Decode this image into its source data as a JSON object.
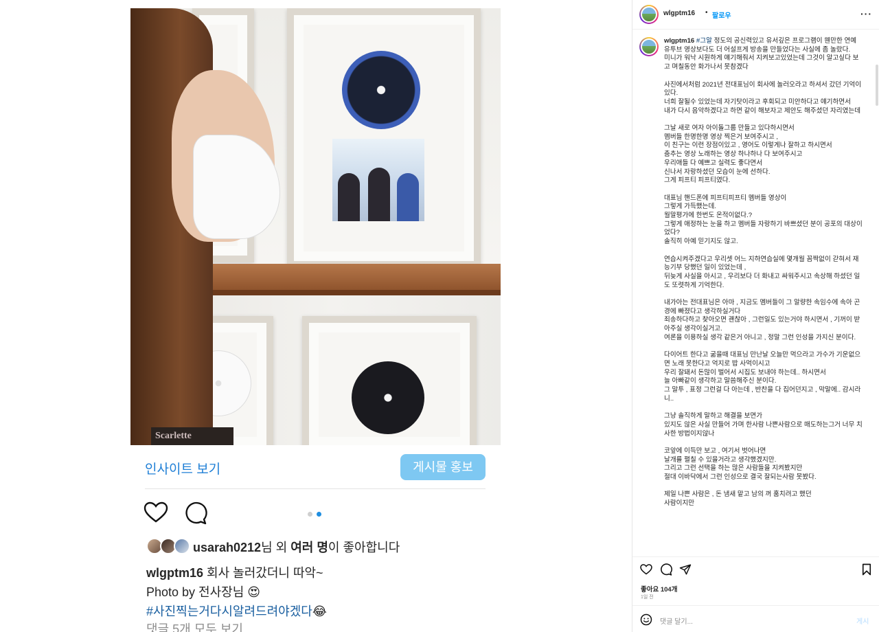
{
  "left_post": {
    "insights_label": "인사이트 보기",
    "promote_label": "게시물 홍보",
    "liked_by_user": "usarah0212",
    "liked_by_suffix": "님 외 ",
    "liked_by_others": "여러 명",
    "liked_by_end": "이 좋아합니다",
    "caption_user": "wlgptm16",
    "caption_line1": " 회사 놀러갔더니 따악~",
    "caption_line2": "Photo by 전사장님 😍",
    "caption_hashtag": "#사진찍는거다시알려드려야겠다",
    "caption_hashtag_emoji": "😂",
    "comments_link": "댓글 5개 모두 보기",
    "photo_label": "Scarlette"
  },
  "right_panel": {
    "header": {
      "username": "wlgptm16",
      "dot": "•",
      "follow_label": "팔로우",
      "more_label": "···"
    },
    "post": {
      "username": "wlgptm16",
      "hashtag": "#그알",
      "lines": [
        " 정도의 공신력있고 유서깊은 프로그램이 웬만한 연예 유투브 영상보다도 더 어설프게 방송을 만들었다는 사실에 좀 놀랐다.",
        "미니가 워낙 시원하게 얘기해줘서 지켜보고있었는데 그것이 알고싶다 보고 며칠동안 화가나서 못참겠다",
        "",
        "사진에서처럼 2021년 전대표님이 회사에 놀러오라고 하셔서 갔던 기억이있다.",
        "너희 잘될수 있었는데 자기탓이라고 후회되고 미안하다고 얘기하면서",
        "내가 다시 음악하겠다고 하면 같이 해보자고 제안도 해주셨던 자리였는데",
        "",
        "그날 새로 여자 아이돌그룹 만들고 있다하시면서",
        "멤버들 한명한명 영상 찍은거 보여주시고 ,",
        "이 친구는 이런 장점이있고 , 영어도 이렇게나 잘하고 하시면서",
        "춤추는 영상 노래하는 영상 하나하나 다 보여주시고",
        "우리애들 다 예쁘고 실력도 좋다면서",
        "신나서 자랑하셨던 모습이 눈에 선하다.",
        "그게 피프티 피프티였다.",
        "",
        "대표님 핸드폰에 피프티피프티 멤버들 영상이",
        "그렇게 가득했는데.",
        "월말평가에 한번도 온적이없다.?",
        "그렇게 애정하는 눈을 하고 멤버들 자랑하기 바쁘셨던 분이 공포의 대상이었다?",
        "솔직히 아예 믿기지도 않고.",
        "",
        "연습시켜주겠다고 우리셋 어느 지하연습실에 몇개월 꼼짝없이 갇혀서 재능기부 당했던 일이 있었는데 ,",
        "뒤늦게 사실을 아시고 , 우리보다 더 화내고 싸워주시고 속상해 하셨던 일도 또렷하게 기억한다.",
        "",
        "내가아는 전대표님은 아마 , 지금도 멤버들이 그 알량한 속임수에 속아 곤경에 빠졌다고 생각하실거다",
        "죄송하다하고 찾아오면 괜찮아 , 그런일도 있는거야 하시면서 , 기꺼이 받아주실 생각이실거고.",
        "여론을 이용하실 생각 같은거 아니고 , 정말 그런 인성을 가지신 분이다.",
        "",
        "다이어트 한다고 굶을때 대표님 만난날 오늘만 먹으라고 가수가 기운없으면 노래 못한다고 억지로 밥 사먹이시고",
        "우리 잘돼서 돈많이 벌어서 시집도 보내야 하는데.. 하시면서",
        "늘 아빠같이 생각하고 말씀해주신 분이다.",
        "그 말투 , 표정 그런걸 다 아는데 , 반찬을 다 집어던지고 , 막말에.. 감시라니..",
        "",
        "그냥 솔직하게 말하고 해결을 보면가",
        "있지도 않은 사실 만들어 가며 한사람 나쁜사람으로 매도하는그거 너무 치사한 방법이지않나",
        "",
        "코앞에 이득만 보고 , 여기서 벗어나면",
        "날개를 펼칠 수 있을거라고 생각했겠지만.",
        "그리고 그런 선택을 하는 많은 사람들을 지켜봤지만",
        "절대 이바닥에서 그런 인성으로 결국 잘되는사람 못봤다.",
        "",
        "제일 나쁜 사람은 , 돈 냄새 맡고 남의 꺼 훔치려고 했던",
        "사람이지만"
      ]
    },
    "actions": {
      "likes_label": "좋아요 104개",
      "time_label": "1일 전",
      "comment_placeholder": "댓글 달기...",
      "post_button": "게시"
    }
  },
  "colors": {
    "link_blue": "#0095f6",
    "promote_bg": "#7ec8f2",
    "insights_blue": "#1f7fd6"
  }
}
